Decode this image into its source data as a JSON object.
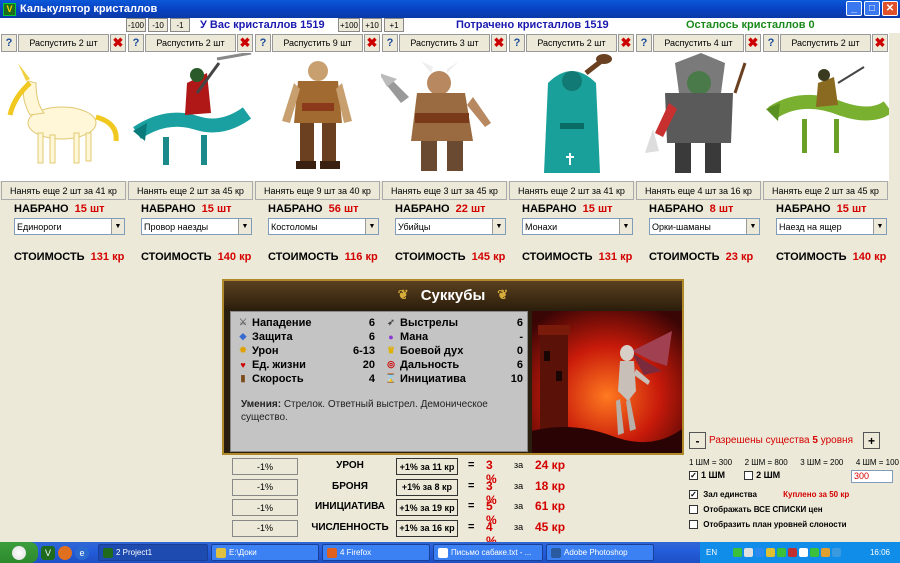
{
  "window": {
    "title": "Калькулятор кристаллов",
    "app_icon": "V",
    "min": "_",
    "max": "□",
    "close": "✕"
  },
  "crystals": {
    "minus_buttons": [
      "-100",
      "-10",
      "-1"
    ],
    "plus_buttons": [
      "+100",
      "+10",
      "+1"
    ],
    "have": "У Вас кристаллов 1519",
    "spent": "Потрачено кристаллов 1519",
    "left": "Осталось кристаллов 0",
    "colors": {
      "have": "#1a1ab0",
      "spent": "#1a1ab0",
      "left": "#1a8a1a"
    }
  },
  "ui": {
    "help": "?",
    "close_x": "✖",
    "collected_label": "НАБРАНО",
    "cost_label": "СТОИМОСТЬ",
    "dropdown_arrow": "▼"
  },
  "units": [
    {
      "dismiss": "Распустить 2 шт",
      "hire": "Нанять еще 2 шт за 41 кр",
      "collected": "15 шт",
      "select": "Единороги",
      "cost": "131 кр",
      "image": "unicorn"
    },
    {
      "dismiss": "Распустить 2 шт",
      "hire": "Нанять еще 2 шт за 45 кр",
      "collected": "15 шт",
      "select": "Провор наезды",
      "cost": "140 кр",
      "image": "lizard-rider"
    },
    {
      "dismiss": "Распустить 9 шт",
      "hire": "Нанять еще 9 шт за 40 кр",
      "collected": "56 шт",
      "select": "Костоломы",
      "cost": "116 кр",
      "image": "brute"
    },
    {
      "dismiss": "Распустить 3 шт",
      "hire": "Нанять еще 3 шт за 45 кр",
      "collected": "22 шт",
      "select": "Убийцы",
      "cost": "145 кр",
      "image": "ogre"
    },
    {
      "dismiss": "Распустить 2 шт",
      "hire": "Нанять еще 2 шт за 41 кр",
      "collected": "15 шт",
      "select": "Монахи",
      "cost": "131 кр",
      "image": "monk"
    },
    {
      "dismiss": "Распустить 4 шт",
      "hire": "Нанять еще 4 шт за 16 кр",
      "collected": "8 шт",
      "select": "Орки-шаманы",
      "cost": "23 кр",
      "image": "orc-shaman"
    },
    {
      "dismiss": "Распустить 2 шт",
      "hire": "Нанять еще 2 шт за 45 кр",
      "collected": "15 шт",
      "select": "Наезд на ящер",
      "cost": "140 кр",
      "image": "raptor-rider"
    }
  ],
  "creature": {
    "name": "Суккубы",
    "ornament_left": "❦",
    "ornament_right": "❦",
    "stats_left": [
      {
        "label": "Нападение",
        "value": "6",
        "icon": "attack-icon",
        "glyph": "⚔",
        "color": "#666"
      },
      {
        "label": "Защита",
        "value": "6",
        "icon": "defense-icon",
        "glyph": "◆",
        "color": "#3a6ad0"
      },
      {
        "label": "Урон",
        "value": "6-13",
        "icon": "damage-icon",
        "glyph": "✸",
        "color": "#e0a000"
      },
      {
        "label": "Ед. жизни",
        "value": "20",
        "icon": "health-icon",
        "glyph": "♥",
        "color": "#c00"
      },
      {
        "label": "Скорость",
        "value": "4",
        "icon": "speed-icon",
        "glyph": "▮",
        "color": "#7a4a1a"
      }
    ],
    "stats_right": [
      {
        "label": "Выстрелы",
        "value": "6",
        "icon": "shots-icon",
        "glyph": "➶",
        "color": "#444"
      },
      {
        "label": "Мана",
        "value": "-",
        "icon": "mana-icon",
        "glyph": "●",
        "color": "#8a3ad0"
      },
      {
        "label": "Боевой дух",
        "value": "0",
        "icon": "morale-icon",
        "glyph": "♛",
        "color": "#e0b000"
      },
      {
        "label": "Дальность",
        "value": "6",
        "icon": "range-icon",
        "glyph": "◎",
        "color": "#c00"
      },
      {
        "label": "Инициатива",
        "value": "10",
        "icon": "initiative-icon",
        "glyph": "⌛",
        "color": "#7a3a10"
      }
    ],
    "abilities_label": "Умения:",
    "abilities_text": "Стрелок. Ответный выстрел. Демоническое существо."
  },
  "upgrades": [
    {
      "minus": "-1%",
      "label": "УРОН",
      "plus": "+1% за 11 кр",
      "eq": "=",
      "percent": "3 %",
      "za": "за",
      "cost": "24 кр"
    },
    {
      "minus": "-1%",
      "label": "БРОНЯ",
      "plus": "+1% за 8 кр",
      "eq": "=",
      "percent": "3 %",
      "za": "за",
      "cost": "18 кр"
    },
    {
      "minus": "-1%",
      "label": "ИНИЦИАТИВА",
      "plus": "+1% за 19 кр",
      "eq": "=",
      "percent": "5 %",
      "za": "за",
      "cost": "61 кр"
    },
    {
      "minus": "-1%",
      "label": "ЧИСЛЕННОСТЬ",
      "plus": "+1% за 16 кр",
      "eq": "=",
      "percent": "4 %",
      "za": "за",
      "cost": "45 кр"
    }
  ],
  "right_panel": {
    "minus": "-",
    "plus": "+",
    "level_text": "Разрешены существа",
    "level_num": "5",
    "level_suffix": "уровня",
    "rates": [
      "1 ШМ = 300",
      "2 ШМ = 800",
      "3 ШМ = 200",
      "4 ШМ = 100"
    ],
    "shm1": "1 ШМ",
    "shm2": "2 ШМ",
    "shm1_checked": true,
    "shm2_checked": false,
    "shm_value": "300",
    "options": [
      {
        "label": "Зал единства",
        "checked": true,
        "extra": "Куплено за 50 кр"
      },
      {
        "label": "Отображать ВСЕ СПИСКИ цен",
        "checked": false,
        "extra": ""
      },
      {
        "label": "Отобразить план уровней слоности",
        "checked": false,
        "extra": ""
      }
    ]
  },
  "taskbar": {
    "tasks": [
      {
        "label": "2 Project1",
        "icon_color": "#1e6b1e",
        "active": true
      },
      {
        "label": "E:\\Доки",
        "icon_color": "#e0c040",
        "active": false
      },
      {
        "label": "4 Firefox",
        "icon_color": "#e06020",
        "active": false
      },
      {
        "label": "Письмо сабаке.txt - ...",
        "icon_color": "#fff",
        "active": false
      },
      {
        "label": "Adobe Photoshop",
        "icon_color": "#2a5aa0",
        "active": false
      }
    ],
    "lang": "EN",
    "clock": "16:06"
  }
}
